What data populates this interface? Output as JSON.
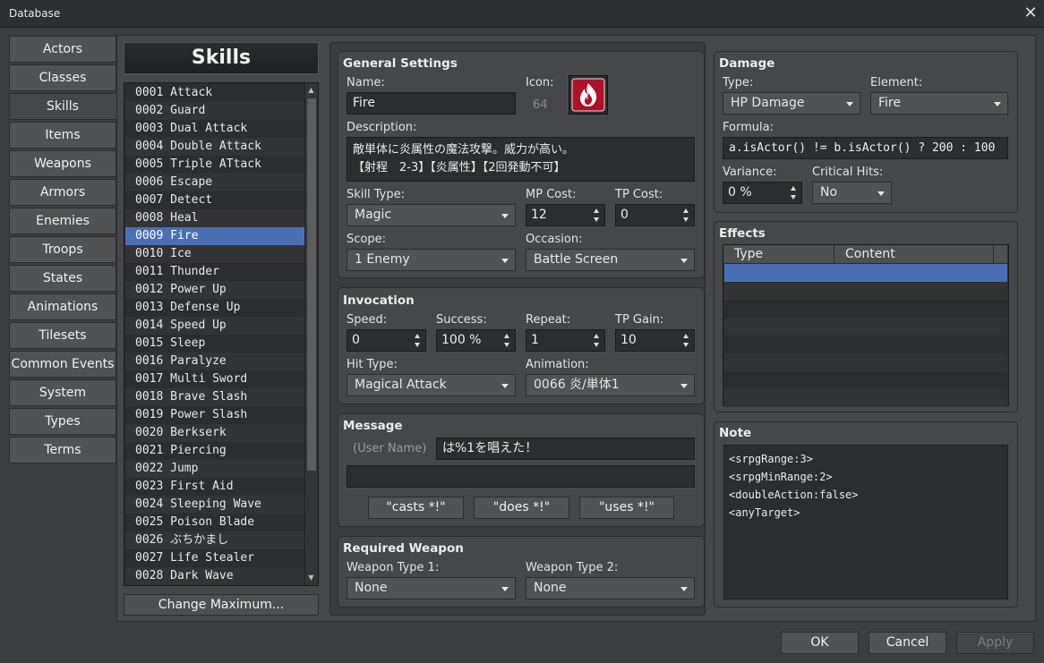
{
  "window": {
    "title": "Database",
    "close_label": "✕"
  },
  "nav": {
    "items": [
      "Actors",
      "Classes",
      "Skills",
      "Items",
      "Weapons",
      "Armors",
      "Enemies",
      "Troops",
      "States",
      "Animations",
      "Tilesets",
      "Common Events",
      "System",
      "Types",
      "Terms"
    ],
    "active": "Skills"
  },
  "list": {
    "header": "Skills",
    "items": [
      "0001 Attack",
      "0002 Guard",
      "0003 Dual Attack",
      "0004 Double Attack",
      "0005 Triple ATtack",
      "0006 Escape",
      "0007 Detect",
      "0008 Heal",
      "0009 Fire",
      "0010 Ice",
      "0011 Thunder",
      "0012 Power Up",
      "0013 Defense Up",
      "0014 Speed Up",
      "0015 Sleep",
      "0016 Paralyze",
      "0017 Multi Sword",
      "0018 Brave Slash",
      "0019 Power Slash",
      "0020 Berkserk",
      "0021 Piercing",
      "0022 Jump",
      "0023 First Aid",
      "0024 Sleeping Wave",
      "0025 Poison Blade",
      "0026 ぶちかまし",
      "0027 Life Stealer",
      "0028 Dark Wave"
    ],
    "selected": "0009 Fire",
    "change_max_label": "Change Maximum..."
  },
  "general": {
    "title": "General Settings",
    "name_label": "Name:",
    "name_value": "Fire",
    "icon_label": "Icon:",
    "icon_index": "64",
    "desc_label": "Description:",
    "desc_line1": "敵単体に炎属性の魔法攻撃。威力が高い。",
    "desc_line2": "【射程　2-3】【炎属性】【2回発動不可】",
    "skilltype_label": "Skill Type:",
    "skilltype_value": "Magic",
    "mpcost_label": "MP Cost:",
    "mpcost_value": "12",
    "tpcost_label": "TP Cost:",
    "tpcost_value": "0",
    "scope_label": "Scope:",
    "scope_value": "1 Enemy",
    "occasion_label": "Occasion:",
    "occasion_value": "Battle Screen"
  },
  "invocation": {
    "title": "Invocation",
    "speed_label": "Speed:",
    "speed_value": "0",
    "success_label": "Success:",
    "success_value": "100 %",
    "repeat_label": "Repeat:",
    "repeat_value": "1",
    "tpgain_label": "TP Gain:",
    "tpgain_value": "10",
    "hittype_label": "Hit Type:",
    "hittype_value": "Magical Attack",
    "animation_label": "Animation:",
    "animation_value": "0066 炎/単体1"
  },
  "message": {
    "title": "Message",
    "username_label": "(User Name)",
    "line1": "は%1を唱えた！",
    "line2": "",
    "btn_casts": "\"casts *!\"",
    "btn_does": "\"does *!\"",
    "btn_uses": "\"uses *!\""
  },
  "weapon": {
    "title": "Required Weapon",
    "wt1_label": "Weapon Type 1:",
    "wt1_value": "None",
    "wt2_label": "Weapon Type 2:",
    "wt2_value": "None"
  },
  "damage": {
    "title": "Damage",
    "type_label": "Type:",
    "type_value": "HP Damage",
    "element_label": "Element:",
    "element_value": "Fire",
    "formula_label": "Formula:",
    "formula_value": "a.isActor() != b.isActor() ? 200 : 100",
    "variance_label": "Variance:",
    "variance_value": "0 %",
    "critical_label": "Critical Hits:",
    "critical_value": "No"
  },
  "effects": {
    "title": "Effects",
    "col_type": "Type",
    "col_content": "Content"
  },
  "note": {
    "title": "Note",
    "lines": [
      "<srpgRange:3>",
      "<srpgMinRange:2>",
      "<doubleAction:false>",
      "<anyTarget>"
    ]
  },
  "footer": {
    "ok": "OK",
    "cancel": "Cancel",
    "apply": "Apply"
  },
  "icons": {
    "skill_icon": "fire-icon",
    "close": "close-icon"
  },
  "colors": {
    "selection": "#4a6fb4",
    "icon_bg": "#b0102a"
  }
}
